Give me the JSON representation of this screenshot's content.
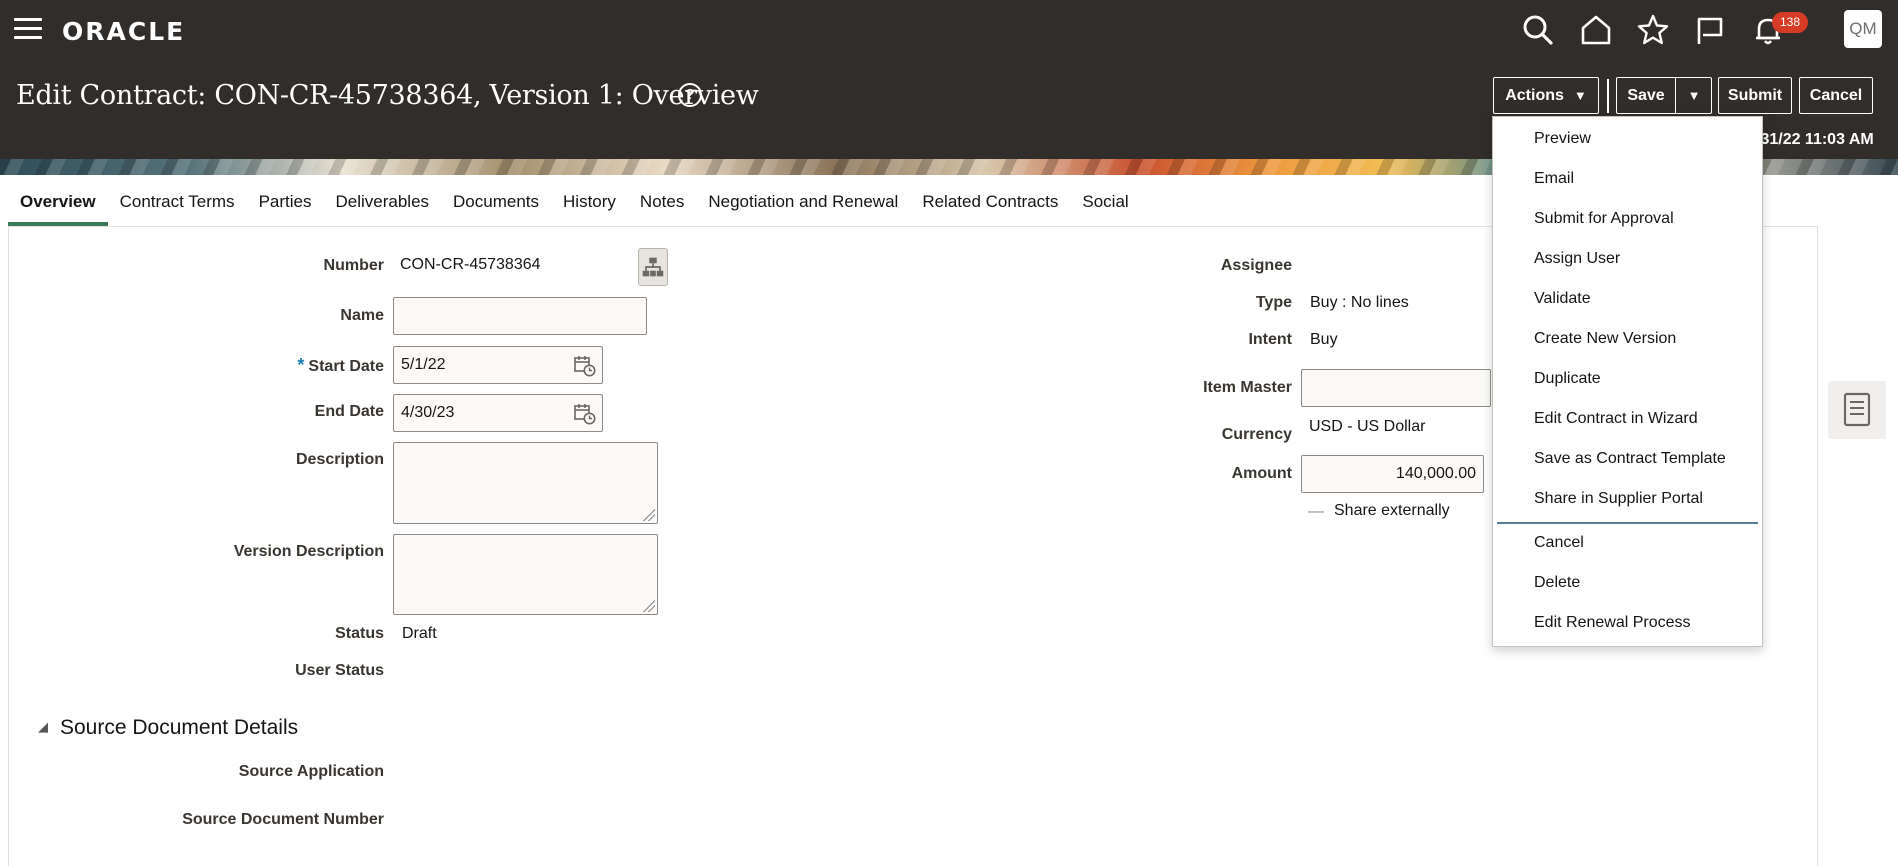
{
  "global": {
    "logo": "ORACLE",
    "notification_count": "138",
    "user_initials": "QM"
  },
  "header": {
    "title": "Edit Contract: CON-CR-45738364, Version 1: Overview",
    "help_glyph": "?",
    "buttons": {
      "actions": "Actions",
      "save": "Save",
      "submit": "Submit",
      "cancel": "Cancel"
    },
    "date_text": "/31/22 11:03 AM"
  },
  "tabs": [
    "Overview",
    "Contract Terms",
    "Parties",
    "Deliverables",
    "Documents",
    "History",
    "Notes",
    "Negotiation and Renewal",
    "Related Contracts",
    "Social"
  ],
  "form": {
    "number": {
      "label": "Number",
      "value": "CON-CR-45738364"
    },
    "name": {
      "label": "Name",
      "value": ""
    },
    "start_date": {
      "label": "Start Date",
      "value": "5/1/22",
      "required_marker": "*"
    },
    "end_date": {
      "label": "End Date",
      "value": "4/30/23"
    },
    "description": {
      "label": "Description",
      "value": ""
    },
    "version_description": {
      "label": "Version Description",
      "value": ""
    },
    "status": {
      "label": "Status",
      "value": "Draft"
    },
    "user_status": {
      "label": "User Status",
      "value": ""
    }
  },
  "right_form": {
    "assignee": {
      "label": "Assignee",
      "value": ""
    },
    "type": {
      "label": "Type",
      "value": "Buy : No lines"
    },
    "intent": {
      "label": "Intent",
      "value": "Buy"
    },
    "item_master": {
      "label": "Item Master",
      "value": ""
    },
    "currency": {
      "label": "Currency",
      "value": "USD - US Dollar"
    },
    "amount": {
      "label": "Amount",
      "value": "140,000.00"
    },
    "share_externally": {
      "label": "Share externally",
      "glyph": "—"
    }
  },
  "source_section": {
    "title": "Source Document Details",
    "source_application": {
      "label": "Source Application",
      "value": ""
    },
    "source_document_number": {
      "label": "Source Document Number",
      "value": ""
    }
  },
  "actions_menu": {
    "items": [
      "Preview",
      "Email",
      "Submit for Approval",
      "Assign User",
      "Validate",
      "Create New Version",
      "Duplicate",
      "Edit Contract in Wizard",
      "Save as Contract Template",
      "Share in Supplier Portal",
      "Cancel",
      "Delete",
      "Edit Renewal Process"
    ]
  },
  "icons": {
    "menu": "hamburger-icon",
    "search": "search-icon",
    "home": "home-icon",
    "favorites": "star-icon",
    "watchlist": "flag-icon",
    "notifications": "bell-icon",
    "hierarchy": "hierarchy-icon",
    "calendar": "calendar-icon",
    "side_panel": "document-icon"
  },
  "colors": {
    "header_bg": "#312d2a",
    "active_tab": "#3d7a59",
    "badge": "#d63b25",
    "required": "#1b7ab6"
  }
}
